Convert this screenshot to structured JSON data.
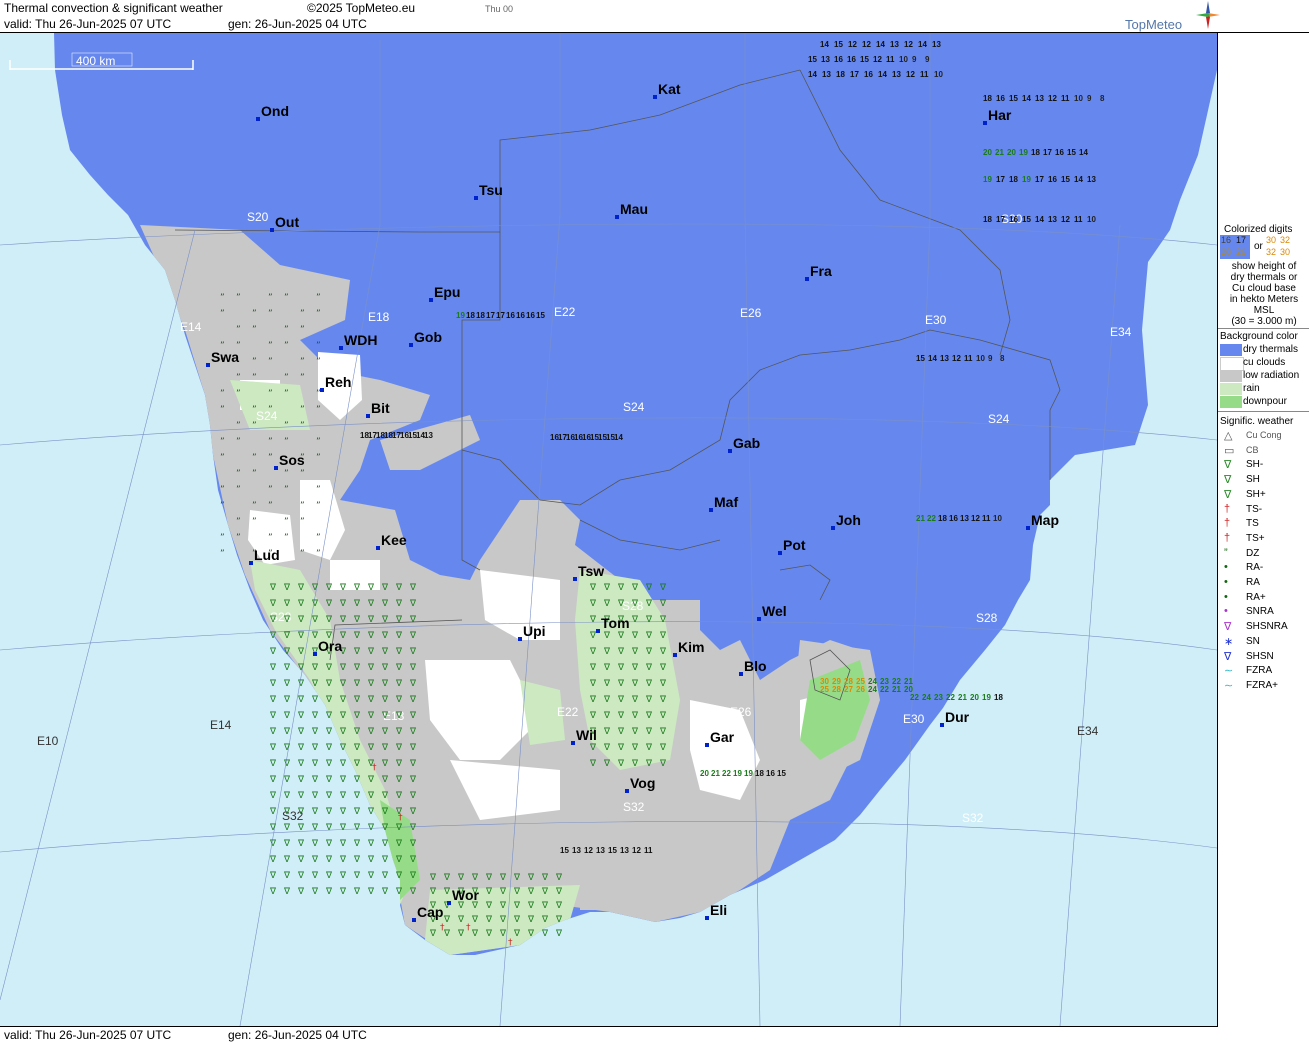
{
  "header": {
    "title": "Thermal convection & significant weather",
    "copyright": "©2025 TopMeteo.eu",
    "day_tab": "Thu 00",
    "valid": "valid:  Thu   26-Jun-2025  07 UTC",
    "gen": "gen: 26-Jun-2025 04 UTC",
    "logo": "TopMeteo"
  },
  "footer": {
    "valid": "valid:  Thu   26-Jun-2025  07 UTC",
    "gen": "gen: 26-Jun-2025 04 UTC"
  },
  "map": {
    "scale_label": "400 km",
    "colors": {
      "sea": "#cfeef8",
      "dry": "#6688ee",
      "cu": "#ffffff",
      "low": "#c8c8c8",
      "rain": "#cde9c2",
      "downpour": "#96dc88"
    },
    "cities": [
      "Ond",
      "Kat",
      "Har",
      "Out",
      "Tsu",
      "Mau",
      "Fra",
      "Epu",
      "Gob",
      "WDH",
      "Swa",
      "Reh",
      "Bit",
      "Sos",
      "Gab",
      "Maf",
      "Joh",
      "Map",
      "Kee",
      "Pot",
      "Lud",
      "Tsw",
      "Wel",
      "Upi",
      "Tom",
      "Ora",
      "Kim",
      "Blo",
      "Dur",
      "Wil",
      "Gar",
      "Vog",
      "Wor",
      "Cap",
      "Eli"
    ],
    "grid_labels": [
      "S20",
      "S20",
      "E14",
      "E18",
      "E22",
      "E26",
      "E30",
      "E34",
      "S24",
      "S24",
      "S24",
      "S28",
      "S28",
      "S28",
      "E14",
      "E18",
      "E22",
      "E26",
      "E30",
      "E34",
      "E10",
      "S32",
      "S32",
      "S32"
    ],
    "digit_rows": [
      "14 15 12 12 14 13 12 14 13",
      "15 13 16 16 15 12 11 10 9 9",
      "14 13 18 17 16 14 13 12 11 10",
      "18 16 15 14 13 12 11 10 9 8",
      "20 21 20 19 18 17 16 15 14",
      "19 17 18 19 17 16 15 14 13",
      "18 17 16 15 14 13 12 11 10",
      "19 18 18 17 17 16 16 16 15",
      "16 17 16 16 16 15 15 15 14",
      "18 17 18 18 17 16 15 14 13",
      "21 22 18 16 13 12 11 10",
      "22 24 23 22 21 20 19 18",
      "25 28 27 26 24 22 21 20",
      "30 29 28 25 24 23 22 21",
      "20 21 22 19 19 18 16 15",
      "15 14 13 12 11 10 9 8",
      "15 13 12 13 15 13 12 11"
    ]
  },
  "legend": {
    "digits_title": [
      "Colorized digits"
    ],
    "digits_samples": [
      "16",
      "17",
      "28",
      "26",
      "30",
      "32",
      "32",
      "30"
    ],
    "digits_or": "or",
    "digits_desc": [
      "show height of",
      "dry thermals or",
      "Cu cloud base",
      "in hekto Meters",
      "MSL",
      "(30 = 3.000 m)"
    ],
    "bg_title": "Background color",
    "bg_items": [
      {
        "label": "dry thermals",
        "color": "#6688ee"
      },
      {
        "label": "cu clouds",
        "color": "#ffffff"
      },
      {
        "label": "low radiation",
        "color": "#c8c8c8"
      },
      {
        "label": "rain",
        "color": "#cde9c2"
      },
      {
        "label": "downpour",
        "color": "#96dc88"
      }
    ],
    "wx_title": "Signific. weather",
    "wx_items": [
      {
        "label": "Cu Cong",
        "color": "#555555"
      },
      {
        "label": "CB",
        "color": "#555555"
      },
      {
        "label": "SH-",
        "color": "#2a8a2a"
      },
      {
        "label": "SH",
        "color": "#2a8a2a"
      },
      {
        "label": "SH+",
        "color": "#2a8a2a"
      },
      {
        "label": "TS-",
        "color": "#cc2222"
      },
      {
        "label": "TS",
        "color": "#cc2222"
      },
      {
        "label": "TS+",
        "color": "#cc2222"
      },
      {
        "label": "DZ",
        "color": "#116611"
      },
      {
        "label": "RA-",
        "color": "#116611"
      },
      {
        "label": "RA",
        "color": "#116611"
      },
      {
        "label": "RA+",
        "color": "#116611"
      },
      {
        "label": "SNRA",
        "color": "#aa33cc"
      },
      {
        "label": "SHSNRA",
        "color": "#aa33cc"
      },
      {
        "label": "SN",
        "color": "#2233cc"
      },
      {
        "label": "SHSN",
        "color": "#2233cc"
      },
      {
        "label": "FZRA",
        "color": "#33bbcc"
      },
      {
        "label": "FZRA+",
        "color": "#33bbcc"
      }
    ]
  }
}
